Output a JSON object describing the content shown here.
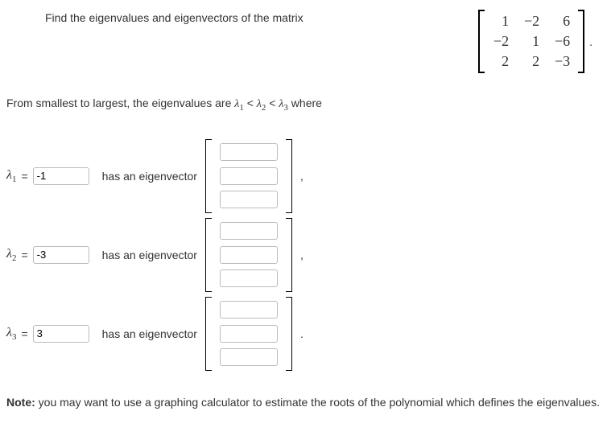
{
  "prompt": "Find the eigenvalues and eigenvectors of the matrix",
  "matrix": {
    "r1": {
      "c1": "1",
      "c2": "−2",
      "c3": "6"
    },
    "r2": {
      "c1": "−2",
      "c2": "1",
      "c3": "−6"
    },
    "r3": {
      "c1": "2",
      "c2": "2",
      "c3": "−3"
    }
  },
  "matrix_period": ".",
  "order_prefix": "From smallest to largest, the eigenvalues are ",
  "order_suffix": " where",
  "lambda_symbol": "λ",
  "lt_symbol": " < ",
  "rows": [
    {
      "sub": "1",
      "value": "-1",
      "has_text": "has an eigenvector",
      "after": ","
    },
    {
      "sub": "2",
      "value": "-3",
      "has_text": "has an eigenvector",
      "after": ","
    },
    {
      "sub": "3",
      "value": "3",
      "has_text": "has an eigenvector",
      "after": "."
    }
  ],
  "equals": "=",
  "note_bold": "Note:",
  "note_rest": " you may want to use a graphing calculator to estimate the roots of the polynomial which defines the eigenvalues."
}
